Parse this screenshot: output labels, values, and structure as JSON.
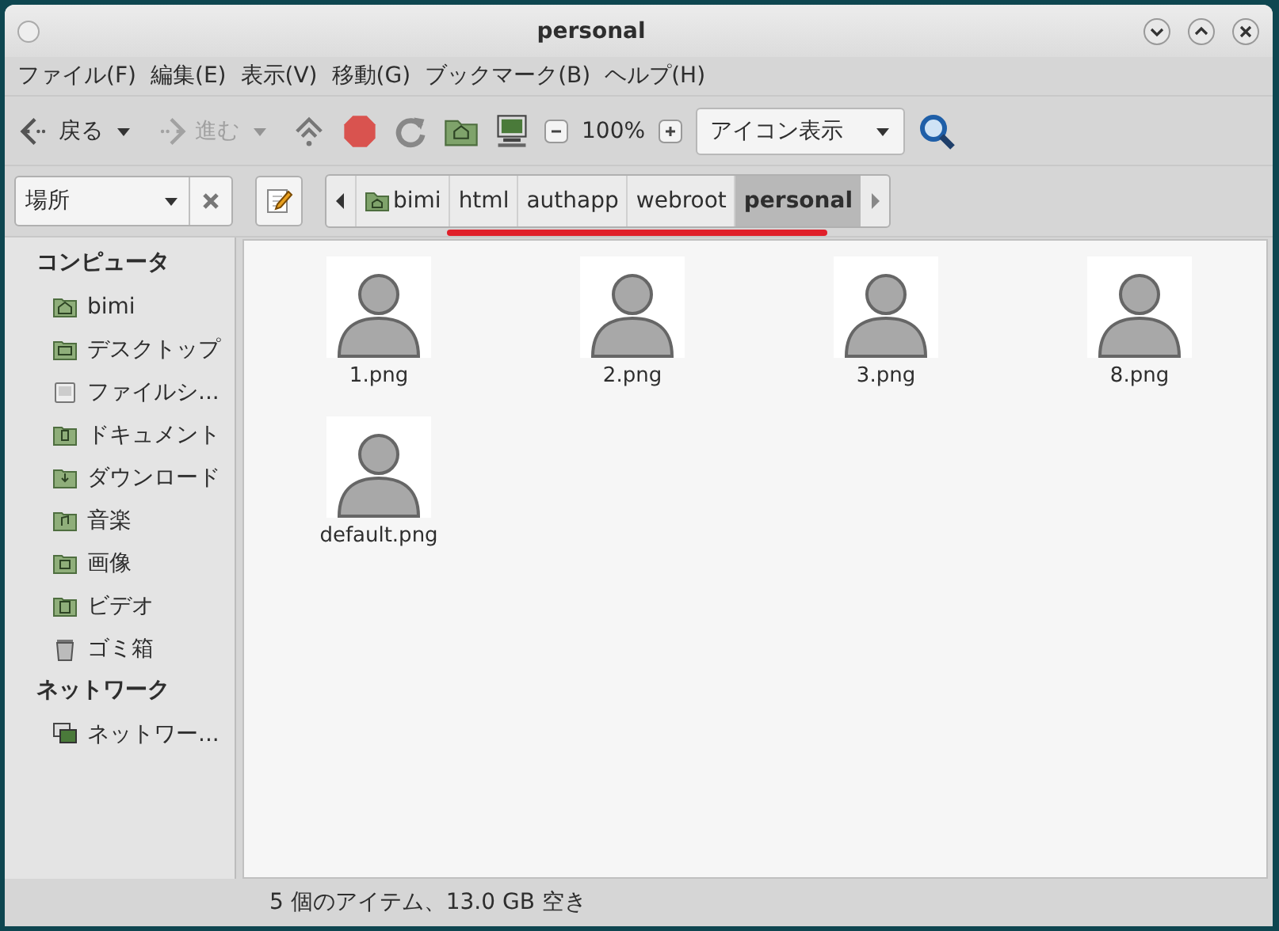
{
  "window": {
    "title": "personal"
  },
  "menu": [
    "ファイル(F)",
    "編集(E)",
    "表示(V)",
    "移動(G)",
    "ブックマーク(B)",
    "ヘルプ(H)"
  ],
  "toolbar": {
    "back": {
      "label": "戻る",
      "disabled": false
    },
    "forward": {
      "label": "進む",
      "disabled": true
    },
    "zoom": "100%",
    "view": "アイコン表示"
  },
  "location": {
    "places": "場所",
    "crumbs": [
      {
        "label": "bimi",
        "kind": "home",
        "selected": false
      },
      {
        "label": "html",
        "kind": "folder",
        "selected": false
      },
      {
        "label": "authapp",
        "kind": "folder",
        "selected": false
      },
      {
        "label": "webroot",
        "kind": "folder",
        "selected": false
      },
      {
        "label": "personal",
        "kind": "folder",
        "selected": true
      }
    ]
  },
  "sidebar": [
    {
      "heading": "コンピュータ",
      "items": [
        {
          "label": "bimi",
          "kind": "home"
        },
        {
          "label": "デスクトップ",
          "kind": "desktop"
        },
        {
          "label": "ファイルシ...",
          "kind": "drive"
        },
        {
          "label": "ドキュメント",
          "kind": "documents"
        },
        {
          "label": "ダウンロード",
          "kind": "downloads"
        },
        {
          "label": "音楽",
          "kind": "music"
        },
        {
          "label": "画像",
          "kind": "pictures"
        },
        {
          "label": "ビデオ",
          "kind": "videos"
        },
        {
          "label": "ゴミ箱",
          "kind": "trash"
        }
      ]
    },
    {
      "heading": "ネットワーク",
      "items": [
        {
          "label": "ネットワー...",
          "kind": "network"
        }
      ]
    }
  ],
  "files": [
    {
      "name": "1.png"
    },
    {
      "name": "2.png"
    },
    {
      "name": "3.png"
    },
    {
      "name": "8.png"
    },
    {
      "name": "default.png"
    }
  ],
  "status_bar": "5 個のアイテム、13.0 GB 空き"
}
